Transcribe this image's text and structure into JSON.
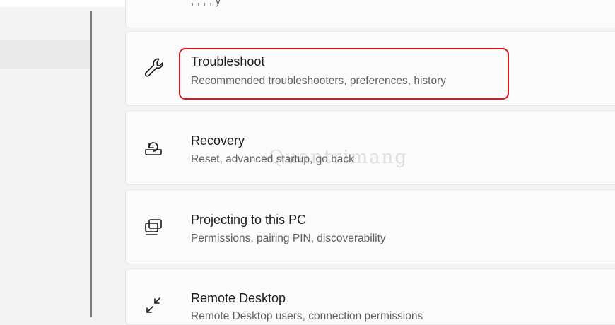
{
  "items": [
    {
      "id": "partial",
      "desc": ", , , ,  y"
    },
    {
      "id": "troubleshoot",
      "title": "Troubleshoot",
      "desc": "Recommended troubleshooters, preferences, history",
      "icon": "wrench-icon",
      "highlighted": true
    },
    {
      "id": "recovery",
      "title": "Recovery",
      "desc": "Reset, advanced startup, go back",
      "icon": "recovery-icon"
    },
    {
      "id": "projecting",
      "title": "Projecting to this PC",
      "desc": "Permissions, pairing PIN, discoverability",
      "icon": "projector-icon"
    },
    {
      "id": "remote",
      "title": "Remote Desktop",
      "desc": "Remote Desktop users, connection permissions",
      "icon": "remote-desktop-icon"
    }
  ],
  "watermark": "Quantrimang",
  "colors": {
    "highlight": "#e0141e",
    "card": "#fbfbfb",
    "background": "#f3f3f3"
  }
}
